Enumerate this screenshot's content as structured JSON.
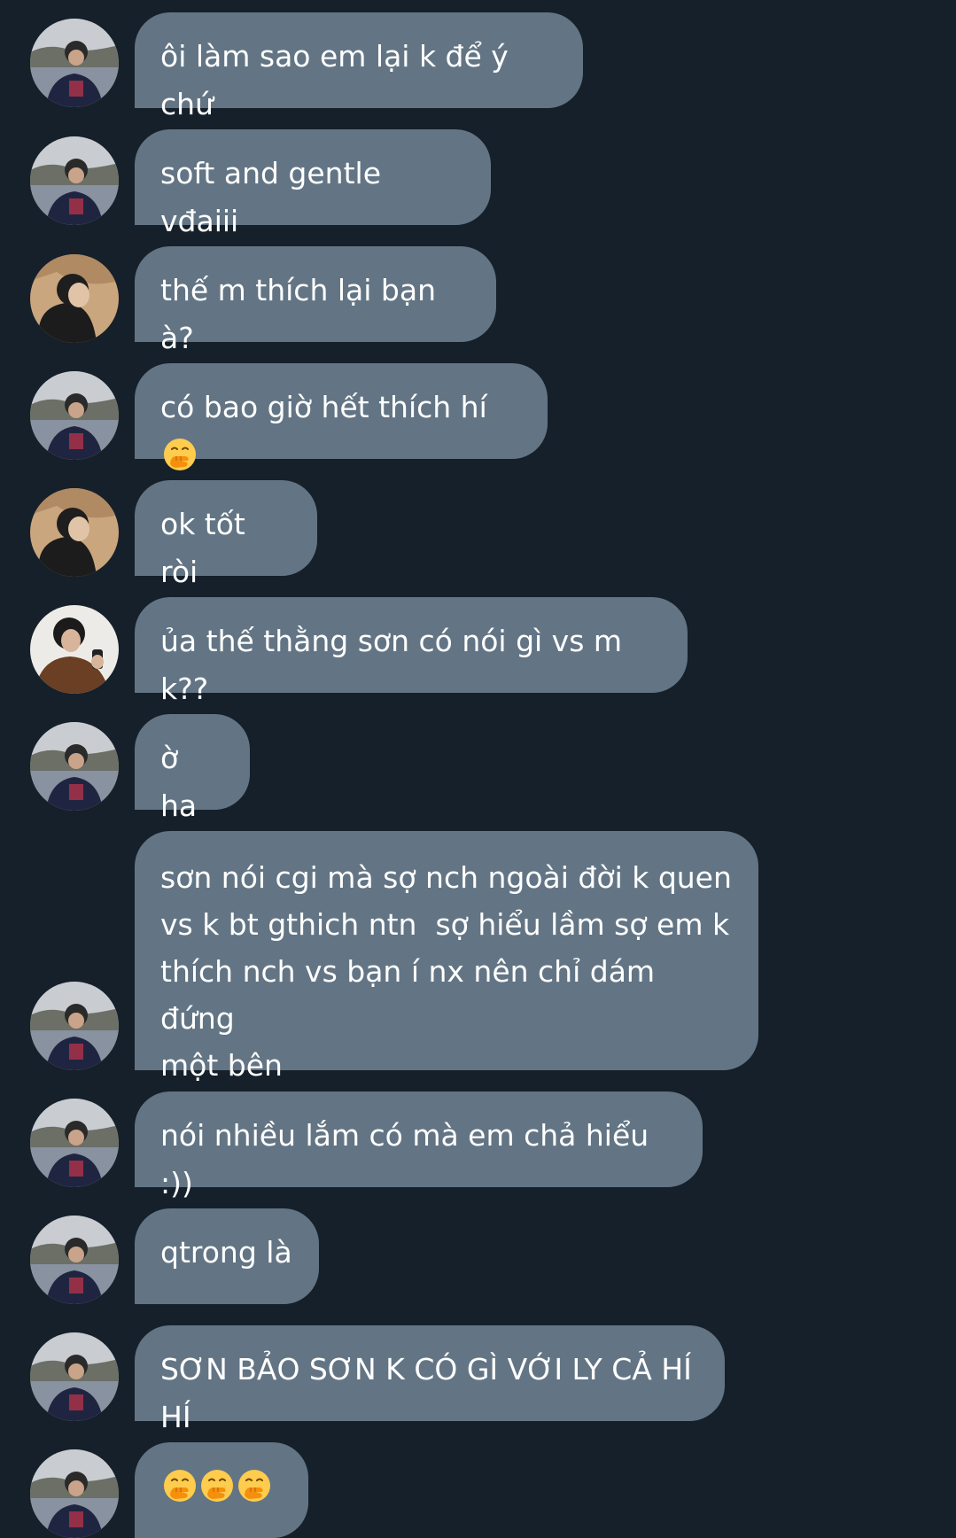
{
  "colors": {
    "background": "#16202a",
    "bubble": "#637584",
    "text": "#ffffff"
  },
  "messages": [
    {
      "text": "ôi làm sao em lại k để ý chứ",
      "avatar": "avatar-a",
      "emoji_suffix": 0
    },
    {
      "text": "soft and gentle vđaiii",
      "avatar": "avatar-a",
      "emoji_suffix": 0
    },
    {
      "text": "thế m thích lại bạn à?",
      "avatar": "avatar-b",
      "emoji_suffix": 0
    },
    {
      "text": "có bao giờ hết thích hí",
      "avatar": "avatar-a",
      "emoji_suffix": 1
    },
    {
      "text": "ok tốt ròi",
      "avatar": "avatar-b",
      "emoji_suffix": 0
    },
    {
      "text": "ủa thế thằng sơn có nói gì vs m k??",
      "avatar": "avatar-c",
      "emoji_suffix": 0
    },
    {
      "text": "ờ ha",
      "avatar": "avatar-a",
      "emoji_suffix": 0
    },
    {
      "text": "sơn nói cgi mà sợ nch ngoài đời k quen\nvs k bt gthich ntn  sợ hiểu lầm sợ em k\nthích nch vs bạn í nx nên chỉ dám đứng\nmột bên",
      "avatar": "avatar-a",
      "emoji_suffix": 0
    },
    {
      "text": "nói nhiều lắm có mà em chả hiểu :))",
      "avatar": "avatar-a",
      "emoji_suffix": 0
    },
    {
      "text": "qtrong là",
      "avatar": "avatar-a",
      "emoji_suffix": 0
    },
    {
      "text": "SƠN BẢO SƠN K CÓ GÌ VỚI LY CẢ HÍ HÍ",
      "avatar": "avatar-a",
      "emoji_suffix": 0
    },
    {
      "text": "",
      "avatar": "avatar-a",
      "emoji_suffix": 3
    }
  ],
  "icons": {
    "emoji": "face-with-hand-over-mouth-icon"
  }
}
